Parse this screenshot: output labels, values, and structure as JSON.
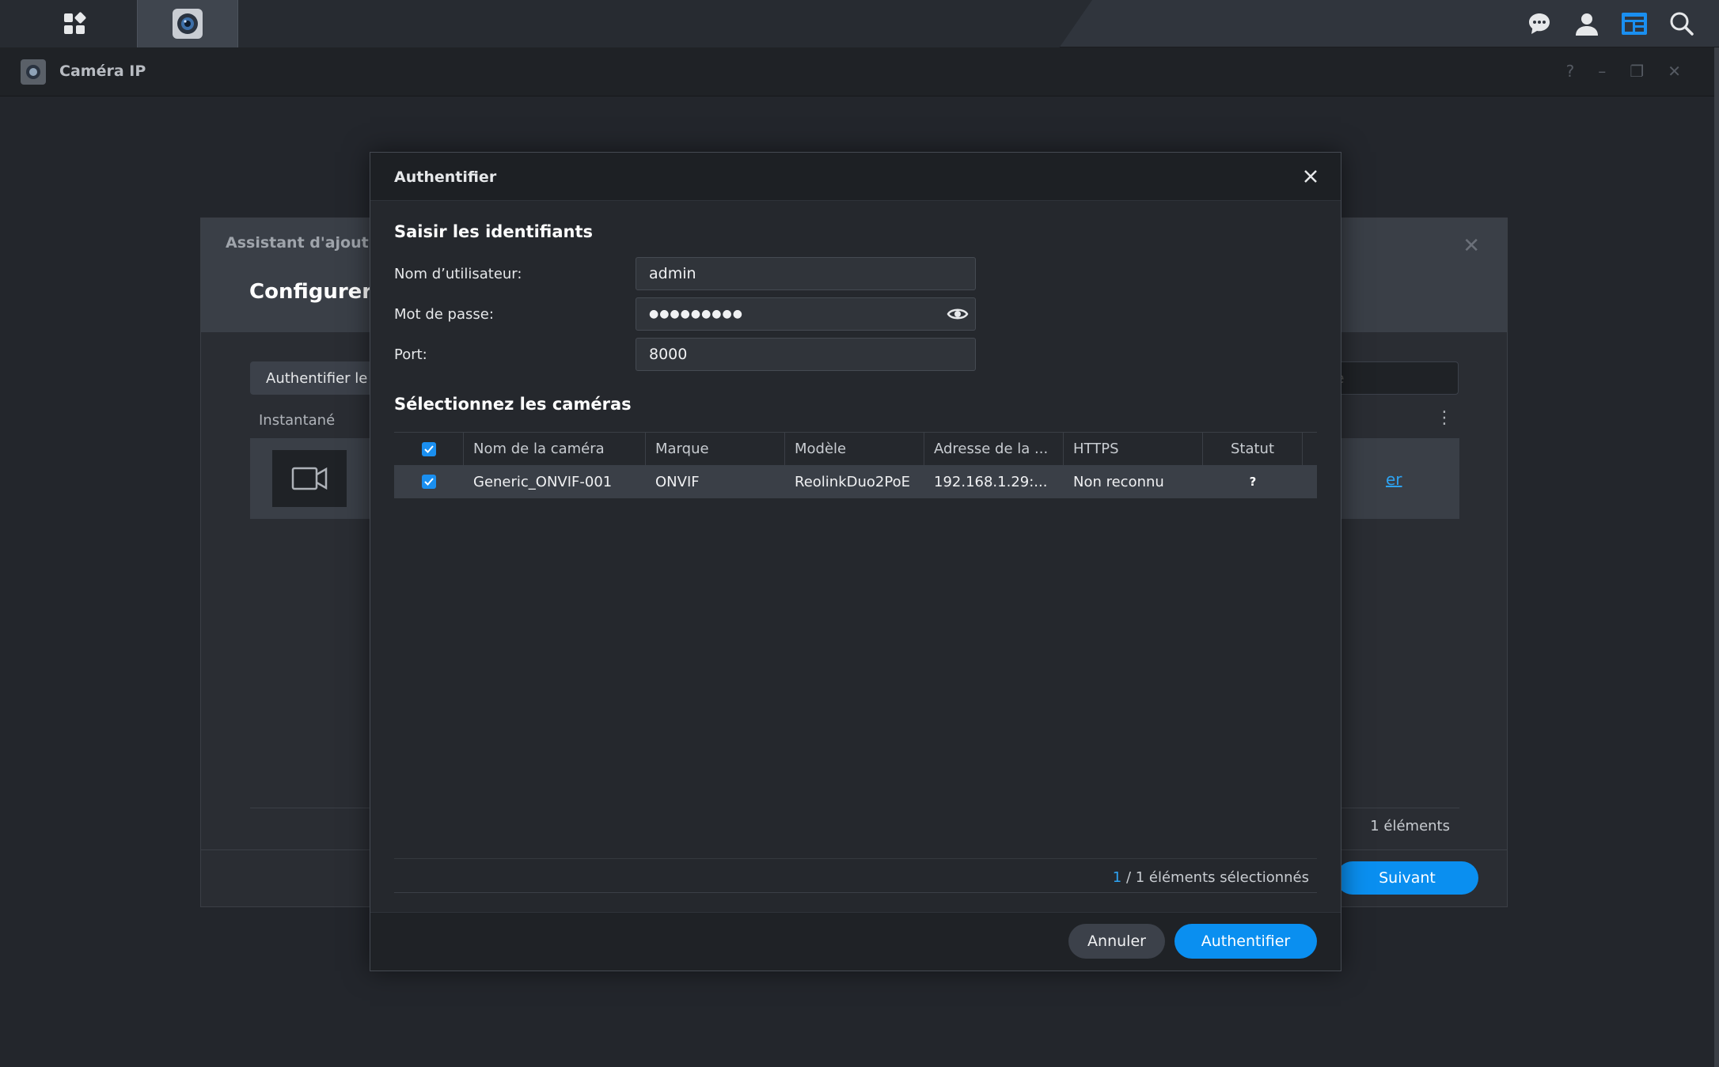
{
  "app": {
    "title": "Caméra IP"
  },
  "taskbar": {
    "icons": [
      "apps-grid-icon",
      "surveillance-camera-icon",
      "chat-icon",
      "user-icon",
      "widget-icon",
      "search-icon"
    ]
  },
  "wizard": {
    "title": "Assistant d'ajout c",
    "subtitle": "Configurer",
    "toolbar_button": "Authentifier le",
    "search_placeholder": "ne",
    "column_snapshot": "Instantané",
    "row_link": "er",
    "count": "1 éléments",
    "next_button": "Suivant"
  },
  "modal": {
    "title": "Authentifier",
    "section_credentials": "Saisir les identifiants",
    "username_label": "Nom d’utilisateur:",
    "username_value": "admin",
    "password_label": "Mot de passe:",
    "password_value": "●●●●●●●●●",
    "port_label": "Port:",
    "port_value": "8000",
    "section_cameras": "Sélectionnez les caméras",
    "table": {
      "headers": [
        "Nom de la caméra",
        "Marque",
        "Modèle",
        "Adresse de la ...",
        "HTTPS",
        "Statut"
      ],
      "rows": [
        {
          "name": "Generic_ONVIF-001",
          "brand": "ONVIF",
          "model": "ReolinkDuo2PoE",
          "address": "192.168.1.29:...",
          "https": "Non reconnu",
          "status": "?"
        }
      ]
    },
    "selected_count": "1",
    "selected_text": " / 1 éléments sélectionnés",
    "cancel_button": "Annuler",
    "auth_button": "Authentifier"
  },
  "colors": {
    "accent": "#0a8ff0",
    "link": "#2ea3f2"
  }
}
